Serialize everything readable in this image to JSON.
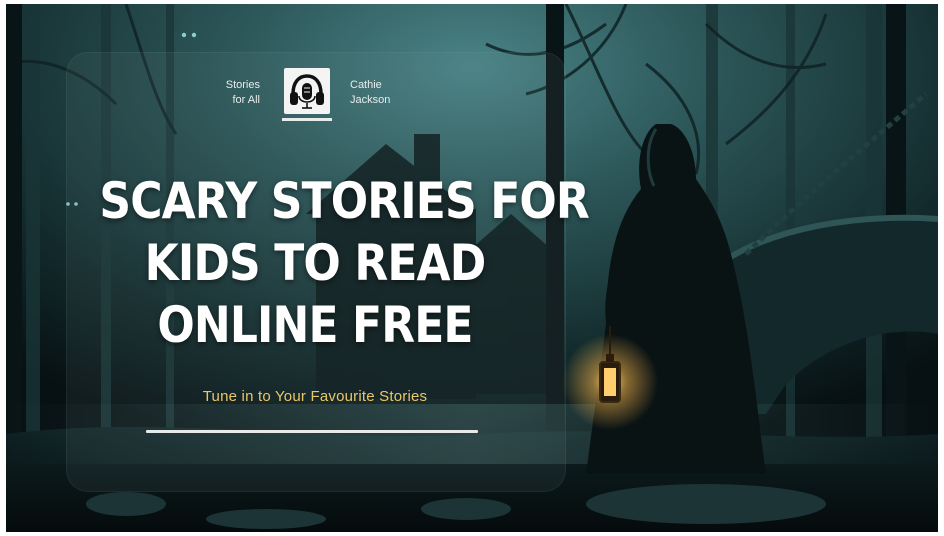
{
  "brand": {
    "left_line1": "Stories",
    "left_line2": "for All",
    "right_line1": "Cathie",
    "right_line2": "Jackson",
    "logo_icon": "headphones-microphone-icon"
  },
  "headline": {
    "line1": "SCARY STORIES FOR",
    "line2": "KIDS TO READ",
    "line3": "ONLINE FREE"
  },
  "tagline": "Tune in to Your Favourite Stories",
  "colors": {
    "sky": "#2f5a5c",
    "forest_dark": "#0b1618",
    "tagline": "#e9c768",
    "lantern_glow": "#f2b24a",
    "text": "#ffffff"
  }
}
